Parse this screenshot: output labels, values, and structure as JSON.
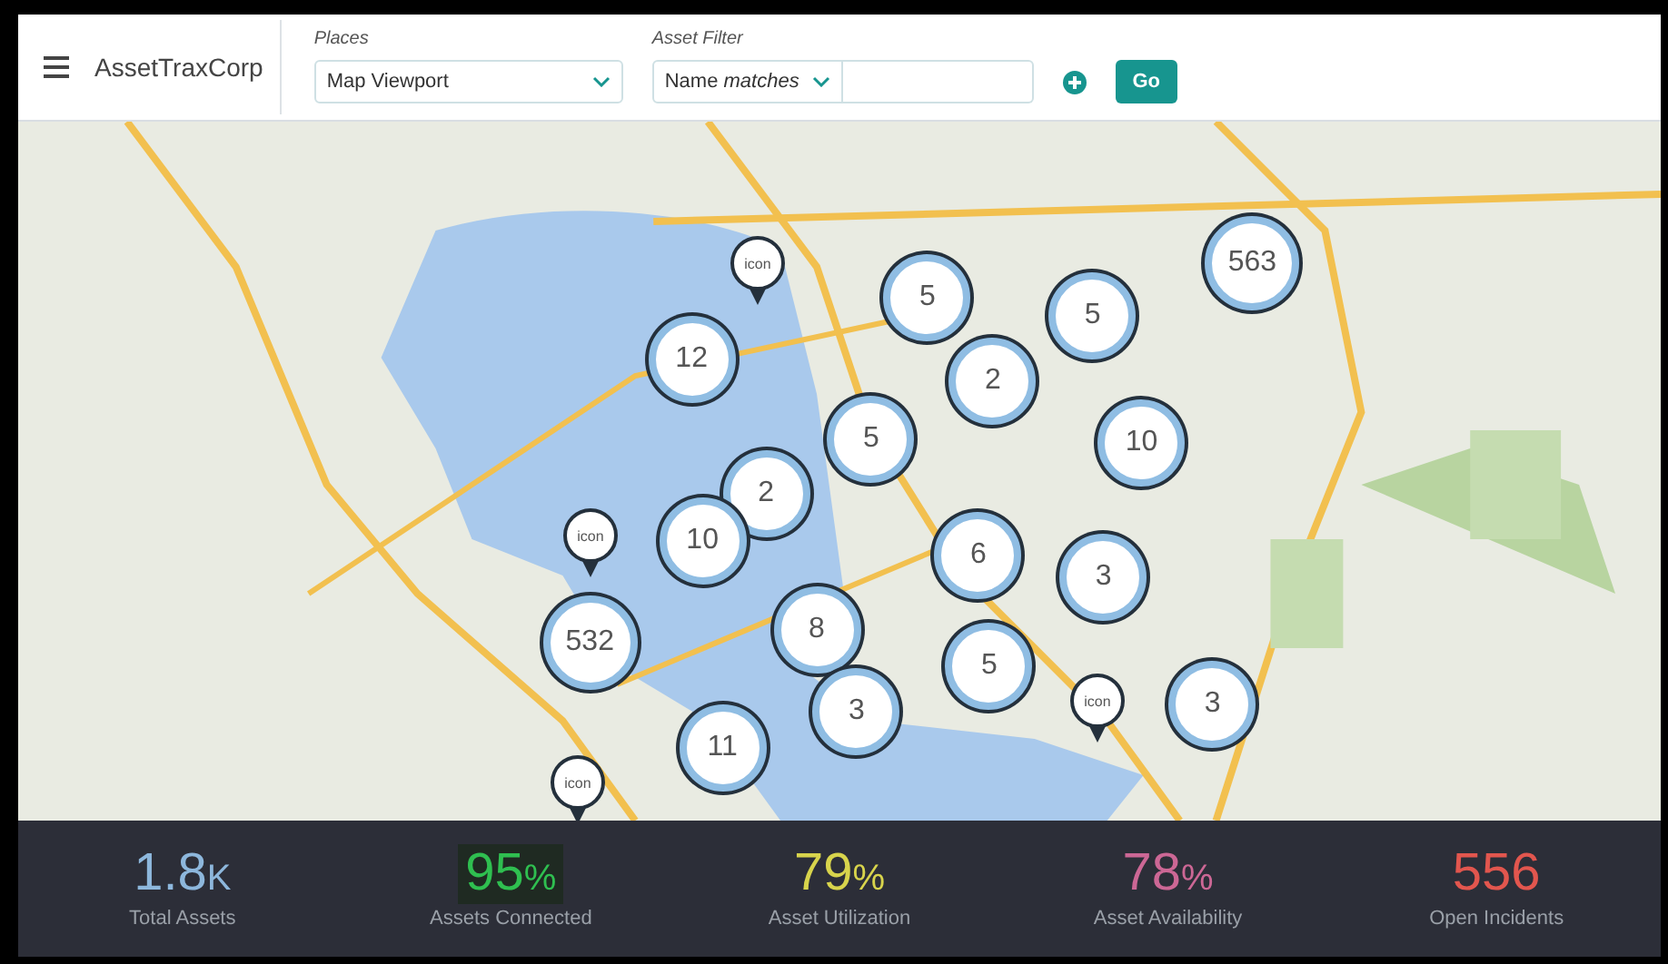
{
  "header": {
    "brand": "AssetTraxCorp",
    "places": {
      "label": "Places",
      "value": "Map Viewport"
    },
    "asset_filter": {
      "label": "Asset Filter",
      "operator": "Name *matches*"
    },
    "go_button": "Go"
  },
  "map": {
    "markers": [
      {
        "kind": "pin",
        "text": "icon"
      },
      {
        "kind": "cluster",
        "text": "563"
      },
      {
        "kind": "cluster",
        "text": "5"
      },
      {
        "kind": "cluster",
        "text": "5"
      },
      {
        "kind": "cluster",
        "text": "12"
      },
      {
        "kind": "cluster",
        "text": "2"
      },
      {
        "kind": "cluster",
        "text": "5"
      },
      {
        "kind": "cluster",
        "text": "10"
      },
      {
        "kind": "cluster",
        "text": "2"
      },
      {
        "kind": "pin",
        "text": "icon"
      },
      {
        "kind": "cluster",
        "text": "10"
      },
      {
        "kind": "cluster",
        "text": "6"
      },
      {
        "kind": "cluster",
        "text": "3"
      },
      {
        "kind": "cluster",
        "text": "532"
      },
      {
        "kind": "cluster",
        "text": "8"
      },
      {
        "kind": "cluster",
        "text": "5"
      },
      {
        "kind": "cluster",
        "text": "3"
      },
      {
        "kind": "pin",
        "text": "icon"
      },
      {
        "kind": "cluster",
        "text": "3"
      },
      {
        "kind": "cluster",
        "text": "11"
      },
      {
        "kind": "pin",
        "text": "icon"
      }
    ]
  },
  "stats": [
    {
      "value": "1.8",
      "unit": "K",
      "label": "Total Assets",
      "color": "#8db7dc",
      "highlighted": false
    },
    {
      "value": "95",
      "unit": "%",
      "label": "Assets Connected",
      "color": "#2fbf50",
      "highlighted": true
    },
    {
      "value": "79",
      "unit": "%",
      "label": "Asset Utilization",
      "color": "#d8d44c",
      "highlighted": false
    },
    {
      "value": "78",
      "unit": "%",
      "label": "Asset Availability",
      "color": "#cc6795",
      "highlighted": false
    },
    {
      "value": "556",
      "label": "Open Incidents",
      "color": "#e2564e",
      "highlighted": false
    }
  ]
}
